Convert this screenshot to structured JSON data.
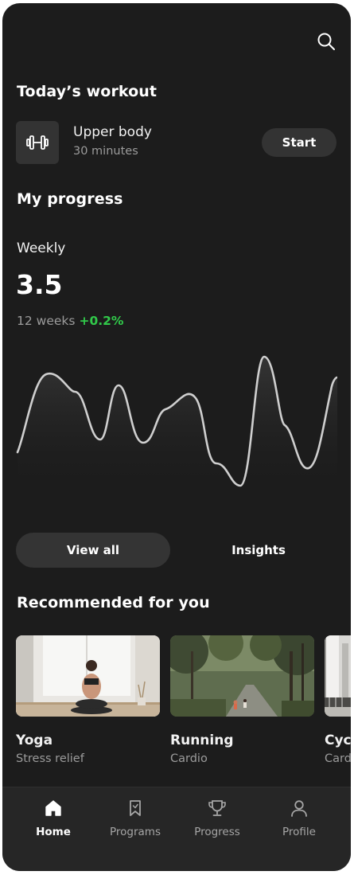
{
  "header": {
    "search_icon": "search-icon"
  },
  "today": {
    "heading": "Today’s workout",
    "workout": {
      "icon": "dumbbell-icon",
      "title": "Upper body",
      "duration": "30 minutes"
    },
    "start_label": "Start"
  },
  "progress": {
    "heading": "My progress",
    "period_label": "Weekly",
    "value": "3.5",
    "range_label": "12 weeks",
    "change": "+0.2%",
    "colors": {
      "line": "#cfcfcf",
      "positive": "#31c94a"
    }
  },
  "segments": {
    "view_all": "View all",
    "insights": "Insights"
  },
  "recommended": {
    "heading": "Recommended for you",
    "cards": [
      {
        "title": "Yoga",
        "subtitle": "Stress relief"
      },
      {
        "title": "Running",
        "subtitle": "Cardio"
      },
      {
        "title": "Cyc",
        "subtitle": "Card"
      }
    ]
  },
  "tabs": [
    {
      "label": "Home",
      "icon": "home-icon",
      "active": true
    },
    {
      "label": "Programs",
      "icon": "bookmark-icon",
      "active": false
    },
    {
      "label": "Progress",
      "icon": "trophy-icon",
      "active": false
    },
    {
      "label": "Profile",
      "icon": "user-icon",
      "active": false
    }
  ]
}
